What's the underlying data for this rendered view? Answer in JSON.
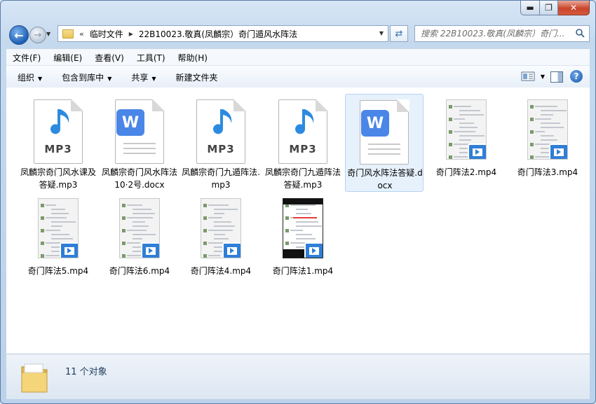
{
  "window": {
    "controls": {
      "minimize": "▬",
      "maximize": "❐",
      "close": "✕"
    }
  },
  "nav": {
    "back": "←",
    "forward": "→",
    "chevrons": "«",
    "breadcrumb": [
      "临时文件",
      "22B10023.敬真(凤麟宗）奇门遁风水阵法"
    ],
    "search_placeholder": "搜索 22B10023.敬真(凤麟宗）奇门..."
  },
  "menu": [
    "文件(F)",
    "编辑(E)",
    "查看(V)",
    "工具(T)",
    "帮助(H)"
  ],
  "commands": [
    {
      "label": "组织",
      "has_arrow": true
    },
    {
      "label": "包含到库中",
      "has_arrow": true
    },
    {
      "label": "共享",
      "has_arrow": true
    },
    {
      "label": "新建文件夹",
      "has_arrow": false
    }
  ],
  "help_label": "?",
  "files": [
    {
      "name": "凤麟宗奇门风水课及答疑.mp3",
      "type": "mp3",
      "badge": "MP3"
    },
    {
      "name": "凤麟宗奇门风水阵法10·2号.docx",
      "type": "docx",
      "badge": "W"
    },
    {
      "name": "凤麟宗奇门九遁阵法.mp3",
      "type": "mp3",
      "badge": "MP3"
    },
    {
      "name": "凤麟宗奇门九遁阵法答疑.mp3",
      "type": "mp3",
      "badge": "MP3"
    },
    {
      "name": "奇门风水阵法答疑.docx",
      "type": "docx",
      "badge": "W",
      "selected": true
    },
    {
      "name": "奇门阵法2.mp4",
      "type": "mp4"
    },
    {
      "name": "奇门阵法3.mp4",
      "type": "mp4"
    },
    {
      "name": "奇门阵法5.mp4",
      "type": "mp4"
    },
    {
      "name": "奇门阵法6.mp4",
      "type": "mp4"
    },
    {
      "name": "奇门阵法4.mp4",
      "type": "mp4"
    },
    {
      "name": "奇门阵法1.mp4",
      "type": "mp4",
      "dark": true
    }
  ],
  "status": {
    "count_text": "11 个对象"
  },
  "colors": {
    "accent": "#2f7fd6",
    "word_blue": "#4a86e8",
    "close_red": "#c9452b"
  }
}
